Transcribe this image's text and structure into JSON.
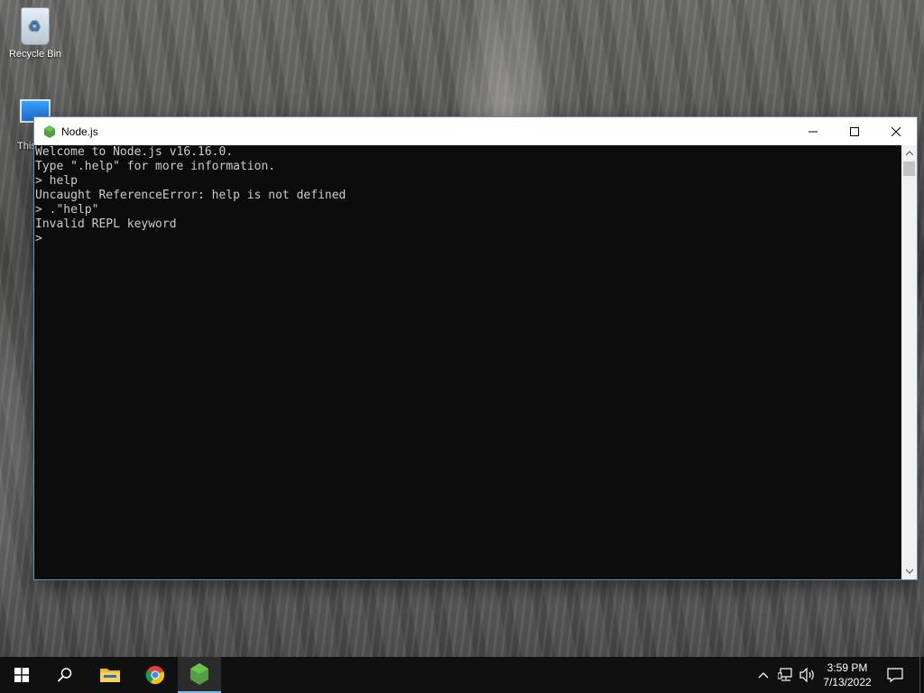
{
  "desktop": {
    "icons": [
      {
        "label": "Recycle Bin",
        "icon": "recycle-bin-icon"
      },
      {
        "label": "This",
        "icon": "this-pc-icon"
      }
    ]
  },
  "window": {
    "title": "Node.js",
    "icon": "nodejs-icon",
    "controls": {
      "minimize": "minimize-icon",
      "maximize": "maximize-icon",
      "close": "close-icon"
    }
  },
  "console": {
    "lines": [
      "Welcome to Node.js v16.16.0.",
      "Type \".help\" for more information.",
      "> help",
      "Uncaught ReferenceError: help is not defined",
      "> .\"help\"",
      "Invalid REPL keyword"
    ],
    "prompt": ">"
  },
  "taskbar": {
    "buttons": [
      {
        "name": "start-button",
        "icon": "windows-logo-icon"
      },
      {
        "name": "search-button",
        "icon": "search-icon"
      },
      {
        "name": "file-explorer-button",
        "icon": "folder-icon"
      },
      {
        "name": "chrome-button",
        "icon": "chrome-icon"
      },
      {
        "name": "nodejs-taskbar-button",
        "icon": "nodejs-icon",
        "active": true
      }
    ],
    "tray": {
      "time": "3:59 PM",
      "date": "7/13/2022"
    }
  },
  "colors": {
    "console_bg": "#0c0c0c",
    "console_text": "#cccccc",
    "taskbar_bg": "#101010",
    "active_indicator": "#76b9ed",
    "node_green": "#539e43"
  }
}
